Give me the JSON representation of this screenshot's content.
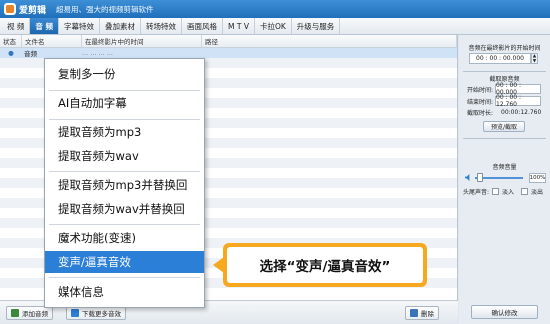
{
  "app": {
    "title": "爱剪辑",
    "slogan": "超易用、强大的视频剪辑软件"
  },
  "menu": {
    "tabs": [
      {
        "label": "视  频"
      },
      {
        "label": "音  频"
      },
      {
        "label": "字幕特效"
      },
      {
        "label": "叠加素材"
      },
      {
        "label": "转场特效"
      },
      {
        "label": "画面风格"
      },
      {
        "label": "M T V"
      },
      {
        "label": "卡拉OK"
      },
      {
        "label": "升级与服务"
      }
    ],
    "active": "音  频"
  },
  "table": {
    "headers": [
      "状态",
      "文件名",
      "在最终影片中的时间",
      "路径"
    ],
    "rows": [
      {
        "name": "音频",
        "info": "...  ...  ...  ..."
      }
    ]
  },
  "bottom": {
    "add_audio": "添加音频",
    "download_audio": "下载更多音效",
    "delete": "删除"
  },
  "right_panel": {
    "start_time_title": "音频在最终影片的开始时间",
    "start_time": "00 : 00 : 00.000",
    "clip_title": "截取原音频",
    "start_label": "开始时间:",
    "start_value": "00 : 00 : 00.000",
    "end_label": "结束时间:",
    "end_value": "00 : 00 : 12.760",
    "duration_label": "截取时长:",
    "duration_value": "00:00:12.760",
    "preview_button": "预览/截取",
    "volume_title": "音频音量",
    "volume_percent": "100%",
    "fade_label": "头尾声音:",
    "fade_in": "淡入",
    "fade_out": "淡出",
    "confirm_button": "确认修改"
  },
  "context_menu": {
    "items": [
      "复制多一份",
      "AI自动加字幕",
      "提取音频为mp3",
      "提取音频为wav",
      "提取音频为mp3并替换回",
      "提取音频为wav并替换回",
      "魔术功能(变速)",
      "变声/逼真音效",
      "媒体信息"
    ],
    "selected": "变声/逼真音效"
  },
  "callout": {
    "text": "选择“变声/逼真音效”"
  },
  "colors": {
    "accent": "#2b7fd6",
    "callout": "#f6a81f",
    "titlebar": "#1f6fba"
  }
}
